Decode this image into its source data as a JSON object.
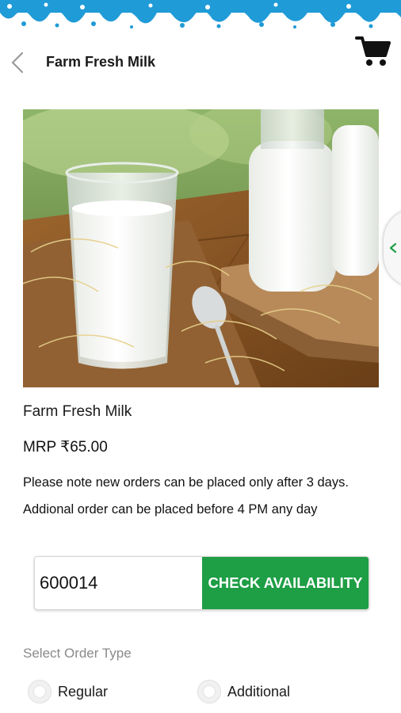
{
  "header": {
    "back_icon": "chevron-left-icon",
    "title": "Farm Fresh Milk",
    "cart_icon": "shopping-cart-icon"
  },
  "product": {
    "image": "milk-glass-and-bottles-photo",
    "name": "Farm Fresh Milk",
    "price": "MRP ₹65.00",
    "notice": "Please note new orders can be placed only after 3 days. Addional order can be placed before 4 PM any day"
  },
  "availability": {
    "pincode_value": "600014",
    "button_label": "CHECK AVAILABILITY"
  },
  "order_type": {
    "label": "Select Order Type",
    "options": [
      {
        "label": "Regular"
      },
      {
        "label": "Additional"
      }
    ]
  },
  "colors": {
    "accent_green": "#1e9e45",
    "splash_blue": "#1f9bd7",
    "side_tab_arrow": "#1e9e45"
  },
  "side_tab_icon": "chevron-left-icon"
}
